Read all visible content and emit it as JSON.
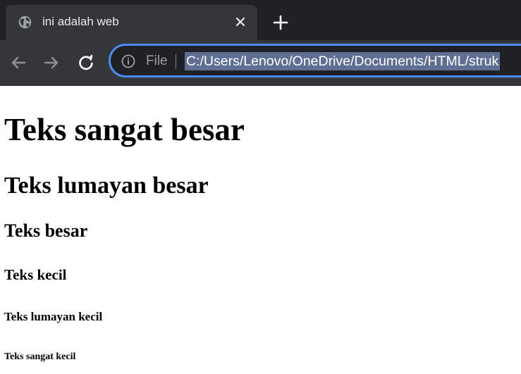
{
  "browser": {
    "tab": {
      "title": "ini adalah web",
      "favicon_icon": "globe-icon",
      "close_icon": "close-icon"
    },
    "new_tab_icon": "plus-icon",
    "toolbar": {
      "back_icon": "arrow-left-icon",
      "forward_icon": "arrow-right-icon",
      "reload_icon": "reload-icon"
    },
    "omnibox": {
      "info_icon": "info-icon",
      "scheme_label": "File",
      "url": "C:/Users/Lenovo/OneDrive/Documents/HTML/struk",
      "url_selected": true
    },
    "colors": {
      "tabstrip_bg": "#202124",
      "active_tab_bg": "#35363a",
      "focus_ring": "#4c8bf5",
      "url_selection": "#5f6f94"
    }
  },
  "page": {
    "headings": [
      "Teks sangat besar",
      "Teks lumayan besar",
      "Teks besar",
      "Teks kecil",
      "Teks lumayan kecil",
      "Teks sangat kecil"
    ]
  }
}
